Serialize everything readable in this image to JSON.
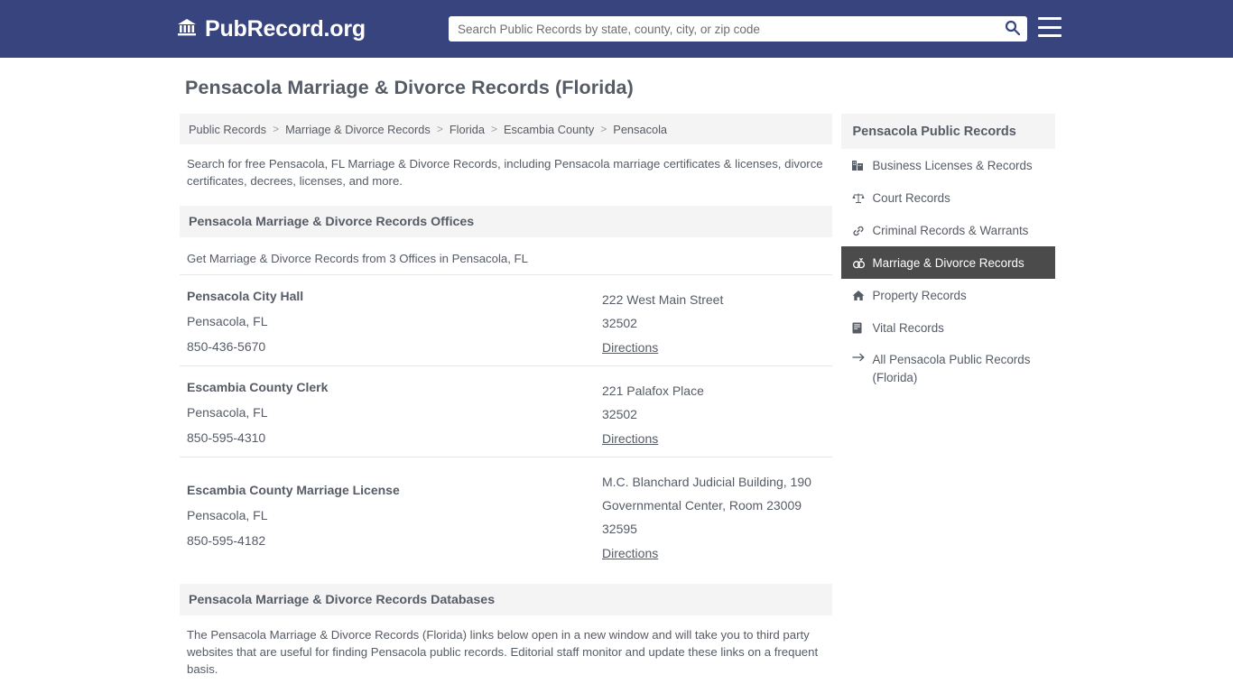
{
  "header": {
    "brand_icon": "bank-icon",
    "brand_text": "PubRecord.org",
    "search_placeholder": "Search Public Records by state, county, city, or zip code",
    "search_value": "",
    "search_button_icon": "search-icon",
    "menu_icon": "hamburger-menu-icon"
  },
  "page": {
    "title": "Pensacola Marriage & Divorce Records (Florida)"
  },
  "breadcrumb": {
    "items": [
      {
        "label": "Public Records"
      },
      {
        "label": "Marriage & Divorce Records"
      },
      {
        "label": "Florida"
      },
      {
        "label": "Escambia County"
      },
      {
        "label": "Pensacola"
      }
    ],
    "separator": ">"
  },
  "intro": "Search for free Pensacola, FL Marriage & Divorce Records, including Pensacola marriage certificates & licenses, divorce certificates, decrees, licenses, and more.",
  "offices_section": {
    "heading": "Pensacola Marriage & Divorce Records Offices",
    "subheading": "Get Marriage & Divorce Records from 3 Offices in Pensacola, FL",
    "directions_label": "Directions",
    "items": [
      {
        "name": "Pensacola City Hall",
        "city": "Pensacola, FL",
        "phone": "850-436-5670",
        "address": "222 West Main Street",
        "zip": "32502"
      },
      {
        "name": "Escambia County Clerk",
        "city": "Pensacola, FL",
        "phone": "850-595-4310",
        "address": "221 Palafox Place",
        "zip": "32502"
      },
      {
        "name": "Escambia County Marriage License",
        "city": "Pensacola, FL",
        "phone": "850-595-4182",
        "address": "M.C. Blanchard Judicial Building, 190 Governmental Center, Room 23009",
        "zip": "32595"
      }
    ]
  },
  "databases_section": {
    "heading": "Pensacola Marriage & Divorce Records Databases",
    "note": "The Pensacola Marriage & Divorce Records (Florida) links below open in a new window and will take you to third party websites that are useful for finding Pensacola public records. Editorial staff monitor and update these links on a frequent basis."
  },
  "sidebar": {
    "heading": "Pensacola Public Records",
    "items": [
      {
        "label": "Business Licenses & Records",
        "icon": "building-icon",
        "glyph": "Ἶ2",
        "active": false
      },
      {
        "label": "Court Records",
        "icon": "scales-icon",
        "glyph": "⚖",
        "active": false
      },
      {
        "label": "Criminal Records & Warrants",
        "icon": "link-icon",
        "glyph": "🔗",
        "active": false
      },
      {
        "label": "Marriage & Divorce Records",
        "icon": "rings-icon",
        "glyph": "⚭",
        "active": true
      },
      {
        "label": "Property Records",
        "icon": "home-icon",
        "glyph": "🏠",
        "active": false
      },
      {
        "label": "Vital Records",
        "icon": "certificate-icon",
        "glyph": "📜",
        "active": false
      },
      {
        "label": "All Pensacola Public Records (Florida)",
        "icon": "arrow-right-icon",
        "glyph": "→",
        "active": false
      }
    ]
  },
  "colors": {
    "header_bg": "#37447e",
    "text": "#555c66",
    "panel_bg": "#f4f4f4",
    "active_bg": "#4b4b4b"
  }
}
